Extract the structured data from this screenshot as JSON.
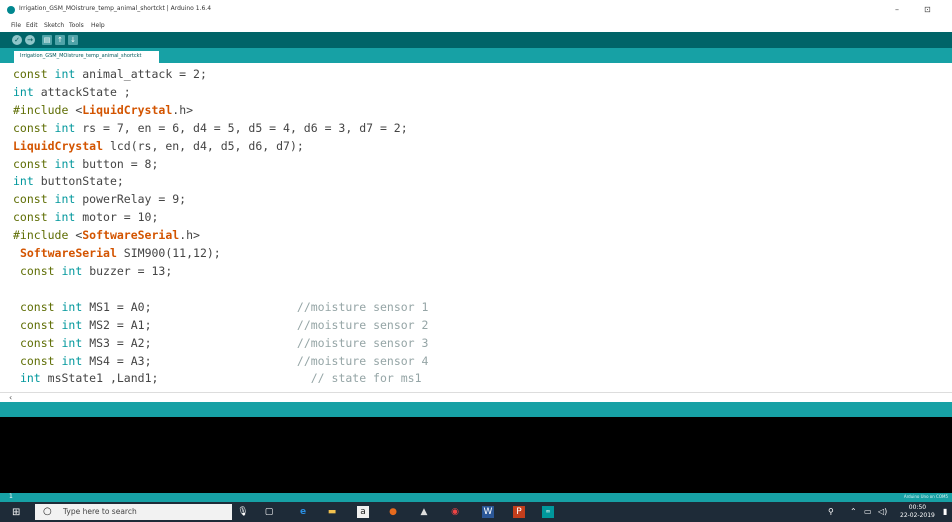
{
  "window": {
    "title": "Irrigation_GSM_MOistrure_temp_animal_shortckt | Arduino 1.6.4",
    "minimize": "–",
    "maximize": "⊡"
  },
  "menu": [
    "File",
    "Edit",
    "Sketch",
    "Tools",
    "Help"
  ],
  "toolbar": {
    "verify": "✓",
    "upload": "→",
    "new": "▤",
    "open": "↑",
    "save": "↓"
  },
  "tab": {
    "label": "Irrigation_GSM_MOistrure_temp_animal_shortckt"
  },
  "code": [
    [
      [
        "kw",
        "const "
      ],
      [
        "ty",
        "int "
      ],
      [
        "t",
        "animal_attack = 2;"
      ]
    ],
    [
      [
        "ty",
        "int "
      ],
      [
        "t",
        "attackState ;"
      ]
    ],
    [
      [
        "pp",
        "#include "
      ],
      [
        "t",
        "<"
      ],
      [
        "cl",
        "LiquidCrystal"
      ],
      [
        "t",
        ".h>"
      ]
    ],
    [
      [
        "kw",
        "const "
      ],
      [
        "ty",
        "int "
      ],
      [
        "t",
        "rs = 7, en = 6, d4 = 5, d5 = 4, d6 = 3, d7 = 2;"
      ]
    ],
    [
      [
        "cl",
        "LiquidCrystal "
      ],
      [
        "t",
        "lcd(rs, en, d4, d5, d6, d7);"
      ]
    ],
    [
      [
        "kw",
        "const "
      ],
      [
        "ty",
        "int "
      ],
      [
        "t",
        "button = 8;"
      ]
    ],
    [
      [
        "ty",
        "int "
      ],
      [
        "t",
        "buttonState;"
      ]
    ],
    [
      [
        "kw",
        "const "
      ],
      [
        "ty",
        "int "
      ],
      [
        "t",
        "powerRelay = 9;"
      ]
    ],
    [
      [
        "kw",
        "const "
      ],
      [
        "ty",
        "int "
      ],
      [
        "t",
        "motor = 10;"
      ]
    ],
    [
      [
        "pp",
        "#include "
      ],
      [
        "t",
        "<"
      ],
      [
        "cl",
        "SoftwareSerial"
      ],
      [
        "t",
        ".h>"
      ]
    ],
    [
      [
        "t",
        " "
      ],
      [
        "cl",
        "SoftwareSerial "
      ],
      [
        "t",
        "SIM900(11,12);"
      ]
    ],
    [
      [
        "t",
        " "
      ],
      [
        "kw",
        "const "
      ],
      [
        "ty",
        "int "
      ],
      [
        "t",
        "buzzer = 13;"
      ]
    ],
    [
      [
        "t",
        ""
      ]
    ],
    [
      [
        "t",
        " "
      ],
      [
        "kw",
        "const "
      ],
      [
        "ty",
        "int "
      ],
      [
        "t",
        "MS1 = A0;                     "
      ],
      [
        "cm",
        "//moisture sensor 1"
      ]
    ],
    [
      [
        "t",
        " "
      ],
      [
        "kw",
        "const "
      ],
      [
        "ty",
        "int "
      ],
      [
        "t",
        "MS2 = A1;                     "
      ],
      [
        "cm",
        "//moisture sensor 2"
      ]
    ],
    [
      [
        "t",
        " "
      ],
      [
        "kw",
        "const "
      ],
      [
        "ty",
        "int "
      ],
      [
        "t",
        "MS3 = A2;                     "
      ],
      [
        "cm",
        "//moisture sensor 3"
      ]
    ],
    [
      [
        "t",
        " "
      ],
      [
        "kw",
        "const "
      ],
      [
        "ty",
        "int "
      ],
      [
        "t",
        "MS4 = A3;                     "
      ],
      [
        "cm",
        "//moisture sensor 4"
      ]
    ],
    [
      [
        "t",
        " "
      ],
      [
        "ty",
        "int "
      ],
      [
        "t",
        "msState1 ,Land1;                      "
      ],
      [
        "cm",
        "// state for ms1"
      ]
    ]
  ],
  "status": {
    "line": "1",
    "board": "Arduino Uno on COM5"
  },
  "taskbar": {
    "search_placeholder": "Type here to search",
    "time": "00:50",
    "date": "22-02-2019"
  },
  "colors": {
    "teal_dark": "#006468",
    "teal": "#17a1a5",
    "keyword": "#5e6d03",
    "type": "#00979c",
    "class": "#d35400",
    "comment": "#95a5a6"
  }
}
